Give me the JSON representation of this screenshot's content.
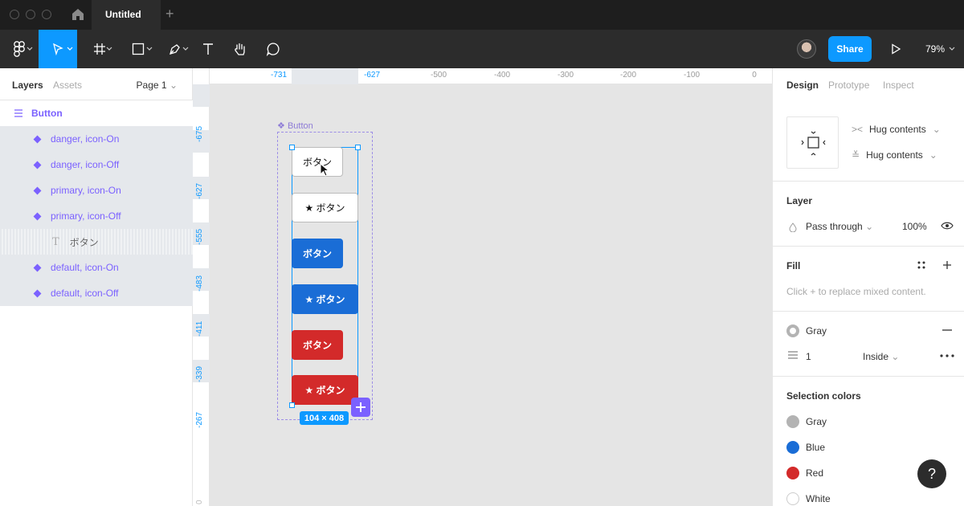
{
  "window": {
    "tab_title": "Untitled"
  },
  "toolbar": {
    "share_label": "Share",
    "zoom": "79%"
  },
  "layers_panel": {
    "tab_layers": "Layers",
    "tab_assets": "Assets",
    "page": "Page 1",
    "root": "Button",
    "items": [
      {
        "label": "danger, icon-On",
        "kind": "variant"
      },
      {
        "label": "danger, icon-Off",
        "kind": "variant"
      },
      {
        "label": "primary, icon-On",
        "kind": "variant"
      },
      {
        "label": "primary, icon-Off",
        "kind": "variant"
      },
      {
        "label": "ボタン",
        "kind": "text"
      },
      {
        "label": "default, icon-On",
        "kind": "variant"
      },
      {
        "label": "default, icon-Off",
        "kind": "variant"
      }
    ]
  },
  "rulers": {
    "top": [
      "-731",
      "-627",
      "-500",
      "-400",
      "-300",
      "-200",
      "-100",
      "0"
    ],
    "left": [
      "-675",
      "-627",
      "-555",
      "-483",
      "-411",
      "-339",
      "-267",
      "0"
    ]
  },
  "canvas": {
    "component_label": "Button",
    "buttons": [
      {
        "text": "ボタン",
        "style": "white"
      },
      {
        "text": "★ ボタン",
        "style": "white"
      },
      {
        "text": "ボタン",
        "style": "blue"
      },
      {
        "text": "★ ボタン",
        "style": "blue"
      },
      {
        "text": "ボタン",
        "style": "red"
      },
      {
        "text": "★ ボタン",
        "style": "red"
      }
    ],
    "size_badge": "104 × 408"
  },
  "design_panel": {
    "tab_design": "Design",
    "tab_prototype": "Prototype",
    "tab_inspect": "Inspect",
    "hug_h": "Hug contents",
    "hug_v": "Hug contents",
    "layer_title": "Layer",
    "blend": "Pass through",
    "opacity": "100%",
    "fill_title": "Fill",
    "fill_hint": "Click + to replace mixed content.",
    "stroke_name": "Gray",
    "stroke_weight": "1",
    "stroke_position": "Inside",
    "selection_title": "Selection colors",
    "colors": [
      {
        "name": "Gray",
        "hex": "#b3b3b3"
      },
      {
        "name": "Blue",
        "hex": "#1a6dd6"
      },
      {
        "name": "Red",
        "hex": "#d32a2a"
      },
      {
        "name": "White",
        "hex": "#ffffff"
      }
    ]
  },
  "help": "?"
}
